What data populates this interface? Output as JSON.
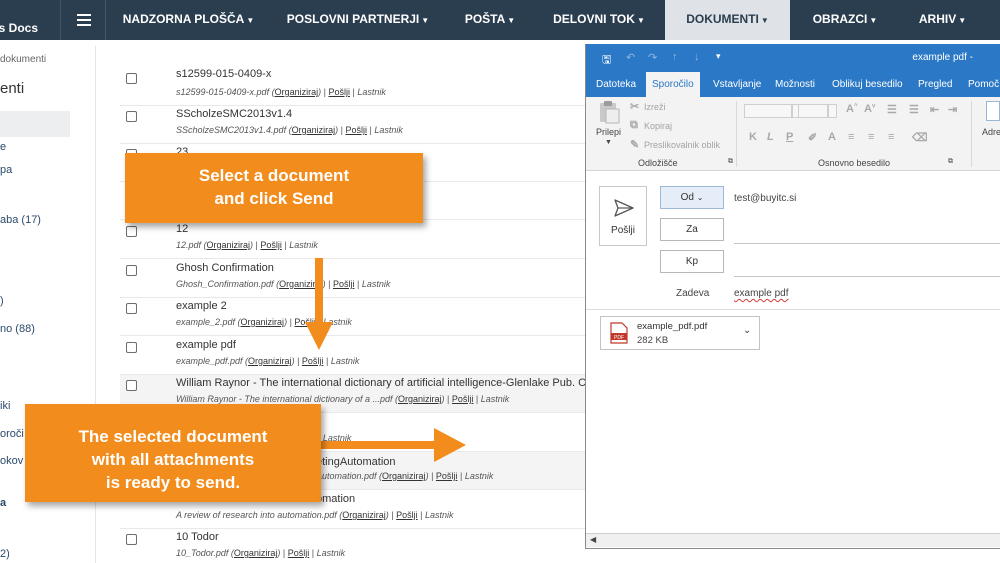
{
  "topnav": {
    "brand": "s Docs",
    "items": [
      {
        "label": "NADZORNA PLOŠČA"
      },
      {
        "label": "POSLOVNI PARTNERJI"
      },
      {
        "label": "POŠTA"
      },
      {
        "label": "DELOVNI TOK"
      },
      {
        "label": "DOKUMENTI",
        "active": true
      },
      {
        "label": "OBRAZCI"
      },
      {
        "label": "ARHIV"
      }
    ]
  },
  "sidebar": {
    "breadcrumb": "dokumenti",
    "title": "enti",
    "fragments": [
      "e",
      "pa",
      "aba (17)",
      ")",
      "no (88)",
      "iki",
      "oroči",
      "okov",
      "a",
      "2)"
    ]
  },
  "documents": [
    {
      "name": "s12599-015-0409-x",
      "file": "s12599-015-0409-x.pdf",
      "organize": "Organiziraj",
      "send": "Pošlji",
      "owner": "Lastnik"
    },
    {
      "name": "SScholzeSMC2013v1.4",
      "file": "SScholzeSMC2013v1.4.pdf",
      "organize": "Organiziraj",
      "send": "Pošlji",
      "owner": "Lastnik"
    },
    {
      "name": "23",
      "file": "",
      "organize": "",
      "send": "",
      "owner": ""
    },
    {
      "name": "",
      "file": "",
      "organize": "",
      "send": "",
      "owner": ""
    },
    {
      "name": "12",
      "file": "12.pdf",
      "organize": "Organiziraj",
      "send": "Pošlji",
      "owner": "Lastnik"
    },
    {
      "name": "Ghosh Confirmation",
      "file": "Ghosh_Confirmation.pdf",
      "organize": "Organiziraj",
      "send": "Pošlji",
      "owner": "Lastnik"
    },
    {
      "name": "example 2",
      "file": "example_2.pdf",
      "organize": "Organiziraj",
      "send": "Pošlji",
      "owner": "Lastnik"
    },
    {
      "name": "example pdf",
      "file": "example_pdf.pdf",
      "organize": "Organiziraj",
      "send": "Pošlji",
      "owner": "Lastnik"
    },
    {
      "name": "William Raynor - The international dictionary of artificial intelligence-Glenlake Pub. Co",
      "file": "William Raynor - The international dictionary of a ...pdf",
      "organize": "Organiziraj",
      "send": "Pošlji",
      "owner": "Lastnik"
    },
    {
      "name": "",
      "file": "",
      "organize": "",
      "send": "",
      "owner": "Lastnik"
    },
    {
      "name": "etingAutomation",
      "file": "Automation.pdf",
      "organize": "Organiziraj",
      "send": "Pošlji",
      "owner": "Lastnik"
    },
    {
      "name": "omation",
      "file": "A review of research into automation.pdf",
      "organize": "Organiziraj",
      "send": "Pošlji",
      "owner": "Lastnik"
    },
    {
      "name": "10 Todor",
      "file": "10_Todor.pdf",
      "organize": "Organiziraj",
      "send": "Pošlji",
      "owner": "Lastnik"
    }
  ],
  "callouts": {
    "first_line1": "Select a document",
    "first_line2": "and click Send",
    "second_line1": "The selected document",
    "second_line2": "with all attachments",
    "second_line3": "is ready to send."
  },
  "outlook": {
    "title": "example pdf  -",
    "tabs": [
      "Datoteka",
      "Sporočilo",
      "Vstavljanje",
      "Možnosti",
      "Oblikuj besedilo",
      "Pregled",
      "Pomoč"
    ],
    "clipboard": {
      "paste": "Prilepi",
      "cut": "Izreži",
      "copy": "Kopiraj",
      "format_painter": "Preslikovalnik oblik",
      "group": "Odložišče"
    },
    "basic_text_group": "Osnovno besedilo",
    "address_fragment": "Adre",
    "send_label": "Pošlji",
    "from_label": "Od",
    "from_value": "test@buyitc.si",
    "to_label": "Za",
    "cc_label": "Kp",
    "subject_label": "Zadeva",
    "subject_value": "example pdf",
    "attachment": {
      "name": "example_pdf.pdf",
      "size": "282 KB",
      "badge": "PDF"
    }
  }
}
